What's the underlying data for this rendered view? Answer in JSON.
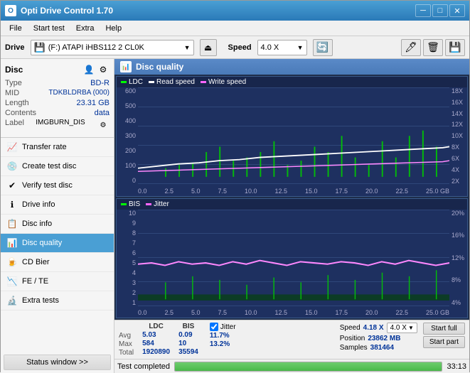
{
  "titlebar": {
    "title": "Opti Drive Control 1.70",
    "icon": "O",
    "controls": {
      "minimize": "─",
      "maximize": "□",
      "close": "✕"
    }
  },
  "menubar": {
    "items": [
      "File",
      "Start test",
      "Extra",
      "Help"
    ]
  },
  "drivebar": {
    "drive_label": "Drive",
    "drive_value": "(F:)  ATAPI iHBS112  2 CL0K",
    "speed_label": "Speed",
    "speed_value": "4.0 X"
  },
  "disc_panel": {
    "title": "Disc",
    "type_label": "Type",
    "type_val": "BD-R",
    "mid_label": "MID",
    "mid_val": "TDKBLDRBA (000)",
    "length_label": "Length",
    "length_val": "23.31 GB",
    "contents_label": "Contents",
    "contents_val": "data",
    "label_label": "Label",
    "label_val": "IMGBURN_DIS"
  },
  "nav": {
    "items": [
      {
        "id": "transfer-rate",
        "label": "Transfer rate",
        "icon": "📈"
      },
      {
        "id": "create-test-disc",
        "label": "Create test disc",
        "icon": "💿"
      },
      {
        "id": "verify-test-disc",
        "label": "Verify test disc",
        "icon": "✔"
      },
      {
        "id": "drive-info",
        "label": "Drive info",
        "icon": "ℹ"
      },
      {
        "id": "disc-info",
        "label": "Disc info",
        "icon": "📋"
      },
      {
        "id": "disc-quality",
        "label": "Disc quality",
        "icon": "📊",
        "active": true
      },
      {
        "id": "cd-bier",
        "label": "CD Bier",
        "icon": "🍺"
      },
      {
        "id": "fe-te",
        "label": "FE / TE",
        "icon": "📉"
      },
      {
        "id": "extra-tests",
        "label": "Extra tests",
        "icon": "🔬"
      }
    ],
    "status_btn": "Status window >>"
  },
  "disc_quality": {
    "title": "Disc quality",
    "chart1": {
      "legend": [
        "LDC",
        "Read speed",
        "Write speed"
      ],
      "yaxis_left": [
        "600",
        "500",
        "400",
        "300",
        "200",
        "100",
        "0"
      ],
      "yaxis_right": [
        "18X",
        "16X",
        "14X",
        "12X",
        "10X",
        "8X",
        "6X",
        "4X",
        "2X"
      ],
      "xaxis": [
        "0.0",
        "2.5",
        "5.0",
        "7.5",
        "10.0",
        "12.5",
        "15.0",
        "17.5",
        "20.0",
        "22.5",
        "25.0 GB"
      ]
    },
    "chart2": {
      "legend": [
        "BIS",
        "Jitter"
      ],
      "yaxis_left": [
        "10",
        "9",
        "8",
        "7",
        "6",
        "5",
        "4",
        "3",
        "2",
        "1"
      ],
      "yaxis_right": [
        "20%",
        "16%",
        "12%",
        "8%",
        "4%"
      ],
      "xaxis": [
        "0.0",
        "2.5",
        "5.0",
        "7.5",
        "10.0",
        "12.5",
        "15.0",
        "17.5",
        "20.0",
        "22.5",
        "25.0 GB"
      ]
    },
    "stats": {
      "headers": [
        "LDC",
        "BIS",
        "",
        "Jitter",
        "Speed",
        "4.18 X",
        "4.0 X"
      ],
      "rows": [
        {
          "label": "Avg",
          "ldc": "5.03",
          "bis": "0.09",
          "jitter": "11.7%"
        },
        {
          "label": "Max",
          "ldc": "584",
          "bis": "10",
          "jitter": "13.2%"
        },
        {
          "label": "Total",
          "ldc": "1920890",
          "bis": "35594",
          "jitter": ""
        }
      ],
      "position_label": "Position",
      "position_val": "23862 MB",
      "samples_label": "Samples",
      "samples_val": "381464",
      "speed_label": "Speed",
      "speed_val": "4.18 X",
      "speed_select": "4.0 X",
      "jitter_checked": true,
      "jitter_label": "Jitter",
      "start_full": "Start full",
      "start_part": "Start part"
    }
  },
  "bottom": {
    "progress": 100,
    "status": "Test completed",
    "time": "33:13"
  }
}
